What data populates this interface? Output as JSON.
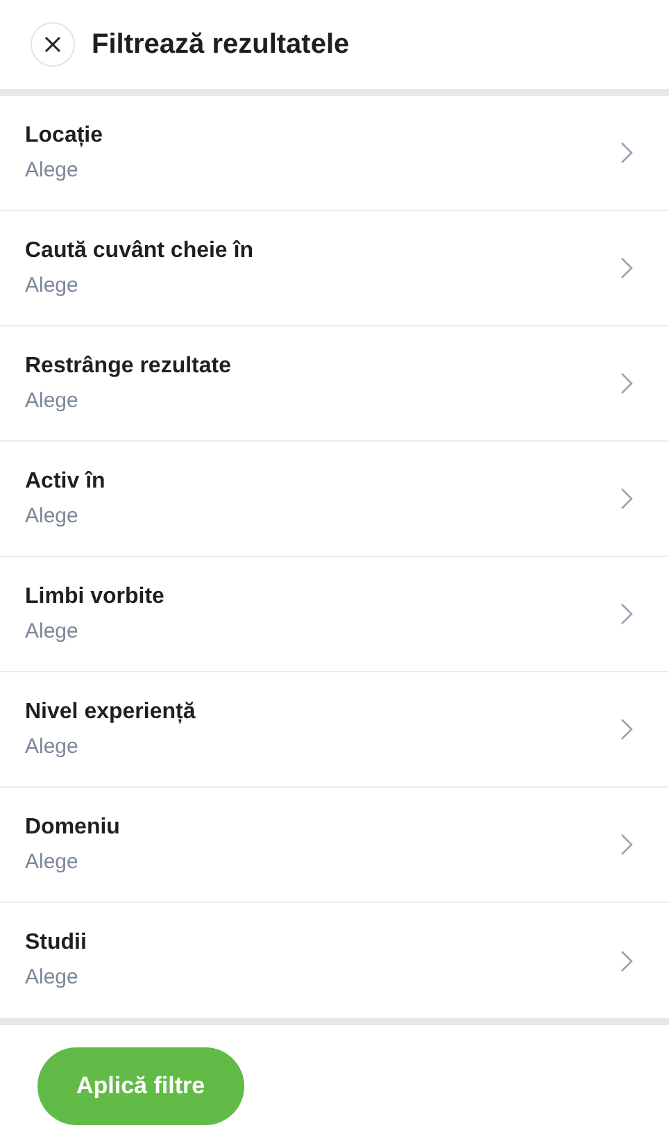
{
  "header": {
    "title": "Filtrează rezultatele"
  },
  "filters": [
    {
      "label": "Locație",
      "value": "Alege"
    },
    {
      "label": "Caută cuvânt cheie în",
      "value": "Alege"
    },
    {
      "label": "Restrânge rezultate",
      "value": "Alege"
    },
    {
      "label": "Activ în",
      "value": "Alege"
    },
    {
      "label": "Limbi vorbite",
      "value": "Alege"
    },
    {
      "label": "Nivel experiență",
      "value": "Alege"
    },
    {
      "label": "Domeniu",
      "value": "Alege"
    },
    {
      "label": "Studii",
      "value": "Alege"
    }
  ],
  "apply_button": "Aplică filtre"
}
